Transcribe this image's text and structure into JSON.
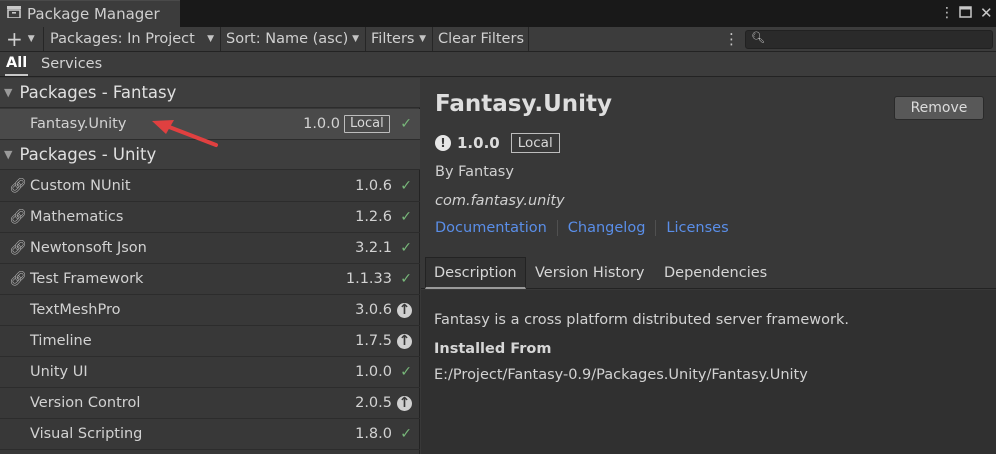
{
  "window": {
    "title": "Package Manager",
    "menu_icon": "kebab-icon",
    "maximize_icon": "maximize-icon",
    "close_icon": "close-icon"
  },
  "toolbar": {
    "add_label": "+",
    "packages_dropdown": "Packages: In Project",
    "sort_dropdown": "Sort: Name (asc)",
    "filters_dropdown": "Filters",
    "clear_filters": "Clear Filters",
    "search_placeholder": ""
  },
  "scope_tabs": [
    {
      "label": "All",
      "active": true
    },
    {
      "label": "Services",
      "active": false
    }
  ],
  "groups": [
    {
      "label": "Packages - Fantasy",
      "items": [
        {
          "name": "Fantasy.Unity",
          "version": "1.0.0",
          "badge": "Local",
          "status": "installed",
          "linked": false,
          "selected": true
        }
      ]
    },
    {
      "label": "Packages - Unity",
      "items": [
        {
          "name": "Custom NUnit",
          "version": "1.0.6",
          "status": "installed",
          "linked": true
        },
        {
          "name": "Mathematics",
          "version": "1.2.6",
          "status": "installed",
          "linked": true
        },
        {
          "name": "Newtonsoft Json",
          "version": "3.2.1",
          "status": "installed",
          "linked": true
        },
        {
          "name": "Test Framework",
          "version": "1.1.33",
          "status": "installed",
          "linked": true
        },
        {
          "name": "TextMeshPro",
          "version": "3.0.6",
          "status": "update",
          "linked": false
        },
        {
          "name": "Timeline",
          "version": "1.7.5",
          "status": "update",
          "linked": false
        },
        {
          "name": "Unity UI",
          "version": "1.0.0",
          "status": "installed",
          "linked": false
        },
        {
          "name": "Version Control",
          "version": "2.0.5",
          "status": "update",
          "linked": false
        },
        {
          "name": "Visual Scripting",
          "version": "1.8.0",
          "status": "installed",
          "linked": false
        }
      ]
    }
  ],
  "details": {
    "title": "Fantasy.Unity",
    "remove_label": "Remove",
    "version": "1.0.0",
    "badge": "Local",
    "author": "By Fantasy",
    "package_id": "com.fantasy.unity",
    "links": [
      "Documentation",
      "Changelog",
      "Licenses"
    ],
    "tabs": [
      "Description",
      "Version History",
      "Dependencies"
    ],
    "active_tab": "Description",
    "description": "Fantasy is a cross platform distributed server framework.",
    "installed_from_label": "Installed From",
    "installed_from_path": "E:/Project/Fantasy-0.9/Packages.Unity/Fantasy.Unity"
  },
  "colors": {
    "link": "#5a8ee8",
    "check": "#78b87a",
    "annotation_arrow": "#e04040"
  }
}
